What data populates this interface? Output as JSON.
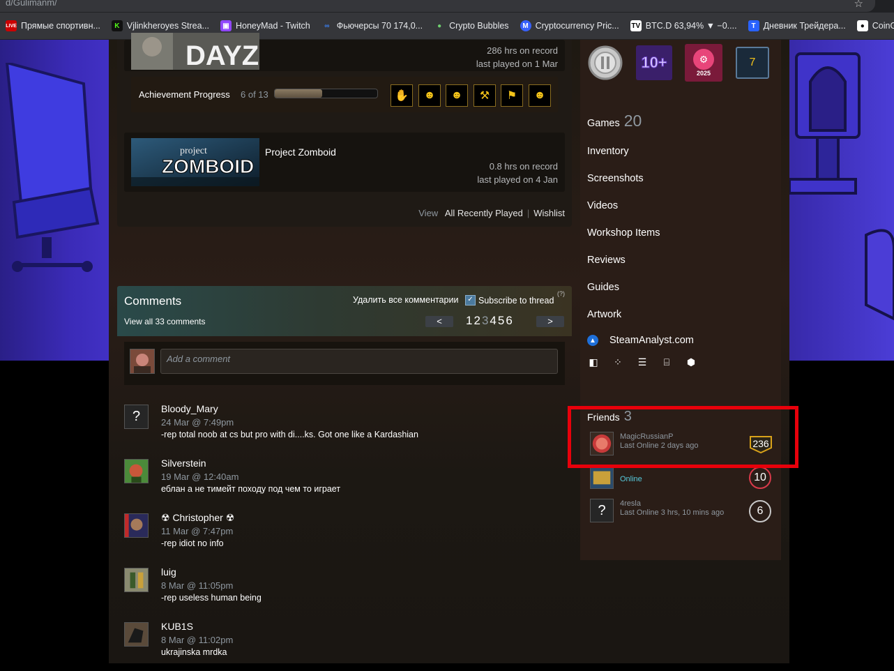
{
  "browser": {
    "url": "d/Gulimanm/",
    "bookmarks": [
      {
        "icon": "live-icon",
        "label": "Прямые спортивн...",
        "color": "#c00"
      },
      {
        "icon": "kick-icon",
        "label": "Vjlinkheroyes Strea...",
        "color": "#111"
      },
      {
        "icon": "twitch-icon",
        "label": "HoneyMad - Twitch",
        "color": "#9147ff"
      },
      {
        "icon": "meta-icon",
        "label": "Фьючерсы 70 174,0...",
        "color": "#0a66ff"
      },
      {
        "icon": "bubbles-icon",
        "label": "Crypto Bubbles",
        "color": "#3c9a3c"
      },
      {
        "icon": "coinmarketcap-icon",
        "label": "Cryptocurrency Pric...",
        "color": "#3861fb"
      },
      {
        "icon": "tradingview-icon",
        "label": "BTC.D 63,94% ▼ −0....",
        "color": "#111"
      },
      {
        "icon": "diary-icon",
        "label": "Дневник Трейдера...",
        "color": "#2962ff"
      },
      {
        "icon": "coinglass-icon",
        "label": "CoinGlass |",
        "color": "#111"
      }
    ]
  },
  "games": {
    "dayz": {
      "title_art": "DAYZ",
      "hours": "286 hrs on record",
      "last_played": "last played on 1 Mar",
      "achievement_label": "Achievement Progress",
      "achievement_count": "6 of 13",
      "achievement_progress": 0.46
    },
    "zomboid": {
      "name": "Project Zomboid",
      "art_top": "project",
      "art_main": "ZOMBOID",
      "hours": "0.8 hrs on record",
      "last_played": "last played on 4 Jan"
    },
    "view": "View",
    "all_recently_played": "All Recently Played",
    "wishlist": "Wishlist"
  },
  "comments": {
    "title": "Comments",
    "view_all": "View all 33 comments",
    "delete_all": "Удалить все комментарии",
    "subscribe": "Subscribe to thread",
    "help": "(?)",
    "prev": "<",
    "next": ">",
    "pages": [
      "1",
      "2",
      "3",
      "4",
      "5",
      "6"
    ],
    "current_page": "3",
    "add_placeholder": "Add a comment",
    "items": [
      {
        "author": "Bloody_Mary",
        "date": "24 Mar @ 7:49pm",
        "text": "-rep total noob at cs but pro with di....ks. Got one like a Kardashian"
      },
      {
        "author": "Silverstein",
        "date": "19 Mar @ 12:40am",
        "text": "еблан а не тимейт походу под чем то играет"
      },
      {
        "author": "☢ Christopher ☢",
        "date": "11 Mar @ 7:47pm",
        "text": "-rep idiot no info"
      },
      {
        "author": "luig",
        "date": "8 Mar @ 11:05pm",
        "text": "-rep useless human being"
      },
      {
        "author": "KUB1S",
        "date": "8 Mar @ 11:02pm",
        "text": "ukrajinska mrdka"
      }
    ]
  },
  "sidebar": {
    "badges": {
      "years": "10+",
      "steam_year": "2025",
      "level": "7"
    },
    "links": [
      {
        "label": "Games",
        "count": "20"
      },
      {
        "label": "Inventory"
      },
      {
        "label": "Screenshots"
      },
      {
        "label": "Videos"
      },
      {
        "label": "Workshop Items"
      },
      {
        "label": "Reviews"
      },
      {
        "label": "Guides"
      },
      {
        "label": "Artwork"
      }
    ],
    "steamanalyst": "SteamAnalyst.com",
    "ext_icons": [
      "tf-icon",
      "dots-icon",
      "stack-icon",
      "bracket-icon",
      "dice-icon"
    ],
    "friends": {
      "title": "Friends",
      "count": "3",
      "list": [
        {
          "name": "MagicRussianP",
          "status": "Last Online 2 days ago",
          "level": "236",
          "online": false
        },
        {
          "name": "",
          "status": "Online",
          "level": "10",
          "online": true
        },
        {
          "name": "4resla",
          "status": "Last Online 3 hrs, 10 mins ago",
          "level": "6",
          "online": false
        }
      ]
    }
  },
  "colors": {
    "highlight": "#e8000b",
    "online": "#57cbde",
    "accent": "#f3c31a"
  }
}
